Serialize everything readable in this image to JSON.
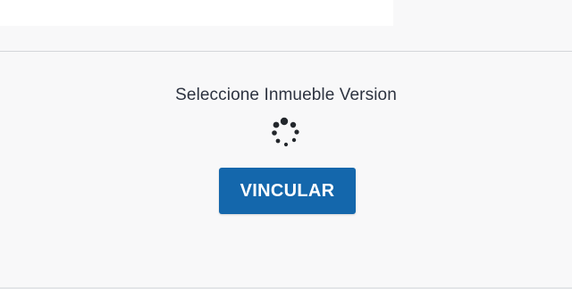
{
  "page": {
    "title": "Seleccione Inmueble Version"
  },
  "actions": {
    "vincular_label": "VINCULAR"
  },
  "icons": {
    "loading": "loading-spinner-icon"
  },
  "colors": {
    "button_bg": "#1467ac",
    "button_text": "#ffffff",
    "title_text": "#2d3340",
    "spinner": "#23272c"
  }
}
